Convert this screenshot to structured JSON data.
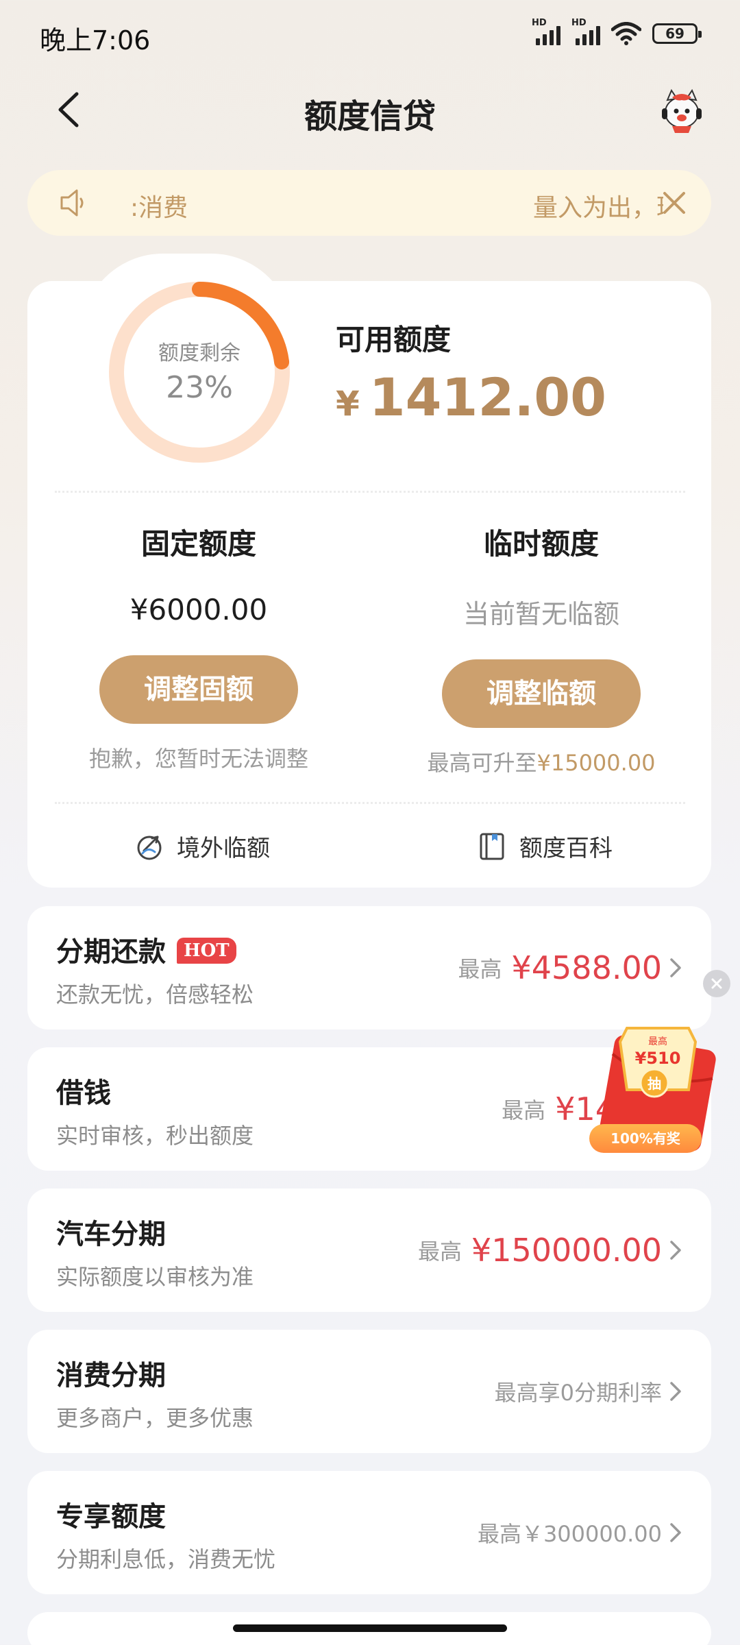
{
  "status_bar": {
    "time": "晚上7:06",
    "signal_label_1": "HD",
    "signal_label_2": "HD",
    "battery": "69"
  },
  "nav": {
    "title": "额度信贷",
    "back_icon": "chevron-left-icon",
    "mascot_icon": "customer-service-mascot-icon"
  },
  "notice": {
    "icon": "speaker-icon",
    "text_left": ":消费",
    "text_right": "量入为出，理",
    "close_icon": "close-icon"
  },
  "quota": {
    "ring_label": "额度剩余",
    "ring_percent_text": "23%",
    "ring_fraction": 0.23,
    "available_label": "可用额度",
    "available_currency": "¥",
    "available_amount": "1412.00",
    "fixed": {
      "title": "固定额度",
      "value": "¥6000.00",
      "button": "调整固额",
      "note": "抱歉，您暂时无法调整"
    },
    "temporary": {
      "title": "临时额度",
      "value": "当前暂无临额",
      "button": "调整临额",
      "note_prefix": "最高可升至",
      "note_amount": "¥15000.00"
    },
    "links": [
      {
        "label": "境外临额",
        "icon": "plane-globe-icon"
      },
      {
        "label": "额度百科",
        "icon": "book-icon"
      }
    ]
  },
  "services": [
    {
      "title": "分期还款",
      "badge": "HOT",
      "subtitle": "还款无忧，倍感轻松",
      "right_label": "最高",
      "right_amount": "¥4588.00"
    },
    {
      "title": "借钱",
      "subtitle": "实时审核，秒出额度",
      "right_label": "最高",
      "right_amount": "¥14"
    },
    {
      "title": "汽车分期",
      "subtitle": "实际额度以审核为准",
      "right_label": "最高",
      "right_amount": "¥150000.00"
    },
    {
      "title": "消费分期",
      "subtitle": "更多商户，更多优惠",
      "right_label": "最高享0分期利率",
      "right_amount": ""
    },
    {
      "title": "专享额度",
      "subtitle": "分期利息低，消费无忧",
      "right_label": "最高￥300000.00",
      "right_amount": ""
    }
  ],
  "promo": {
    "amount": "¥510",
    "top_text": "最高",
    "draw_text": "抽",
    "badge": "100%有奖",
    "close_icon": "close-icon"
  },
  "colors": {
    "accent_gold": "#cca06e",
    "amount_gold": "#b58a5c",
    "ring_orange": "#f47c2c",
    "ring_track": "#fde0cc",
    "price_red": "#e0434b",
    "notice_bg": "#fdf6e3"
  }
}
